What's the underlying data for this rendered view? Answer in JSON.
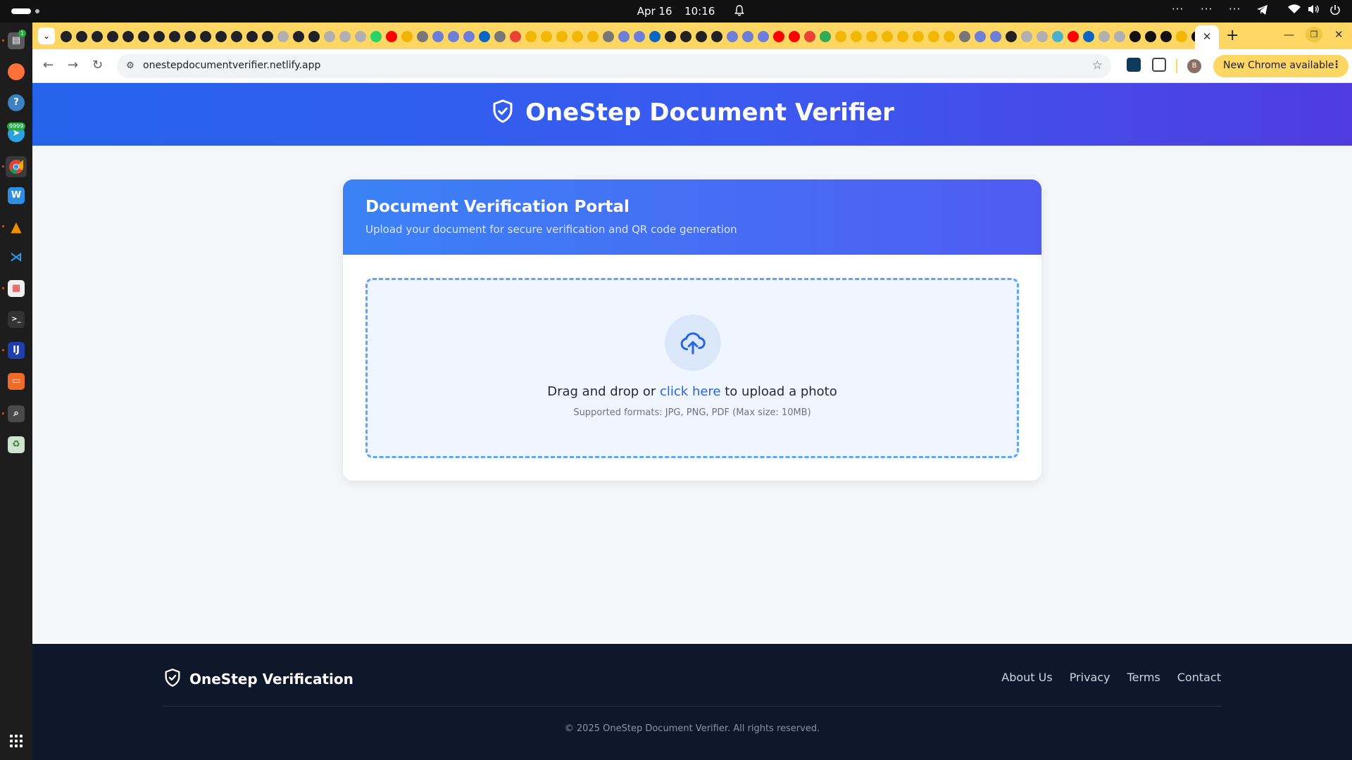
{
  "system": {
    "date": "Apr 16",
    "time": "10:16"
  },
  "dock": {
    "items": [
      {
        "icon": "files-icon",
        "badge": "1"
      },
      {
        "icon": "firefox-icon"
      },
      {
        "icon": "help-icon"
      },
      {
        "icon": "telegram-icon",
        "badge": "9999"
      },
      {
        "icon": "chrome-icon"
      },
      {
        "icon": "writer-icon"
      },
      {
        "icon": "vlc-icon"
      },
      {
        "icon": "vscode-icon"
      },
      {
        "icon": "document-viewer-icon"
      },
      {
        "icon": "terminal-icon"
      },
      {
        "icon": "jetbrains-icon"
      },
      {
        "icon": "presentation-icon"
      },
      {
        "icon": "screenshot-icon"
      },
      {
        "icon": "trash-icon"
      }
    ]
  },
  "browser": {
    "url": "onestepdocumentverifier.netlify.app",
    "update_label": "New Chrome available"
  },
  "site": {
    "header_title": "OneStep Document Verifier",
    "card": {
      "title": "Document Verification Portal",
      "subtitle": "Upload your document for secure verification and QR code generation"
    },
    "upload": {
      "text_before": "Drag and drop or",
      "link_text": "click here",
      "text_after": "to upload a photo",
      "formats": "Supported formats: JPG, PNG, PDF (Max size: 10MB)"
    },
    "footer": {
      "brand": "OneStep Verification",
      "links": [
        "About Us",
        "Privacy",
        "Terms",
        "Contact"
      ],
      "copyright": "© 2025 OneStep Document Verifier. All rights reserved."
    }
  },
  "colors": {
    "accent": "#2563eb",
    "header_gradient_end": "#4f3ce0",
    "footer_bg": "#0f172a",
    "tabstrip": "#fdd663"
  }
}
